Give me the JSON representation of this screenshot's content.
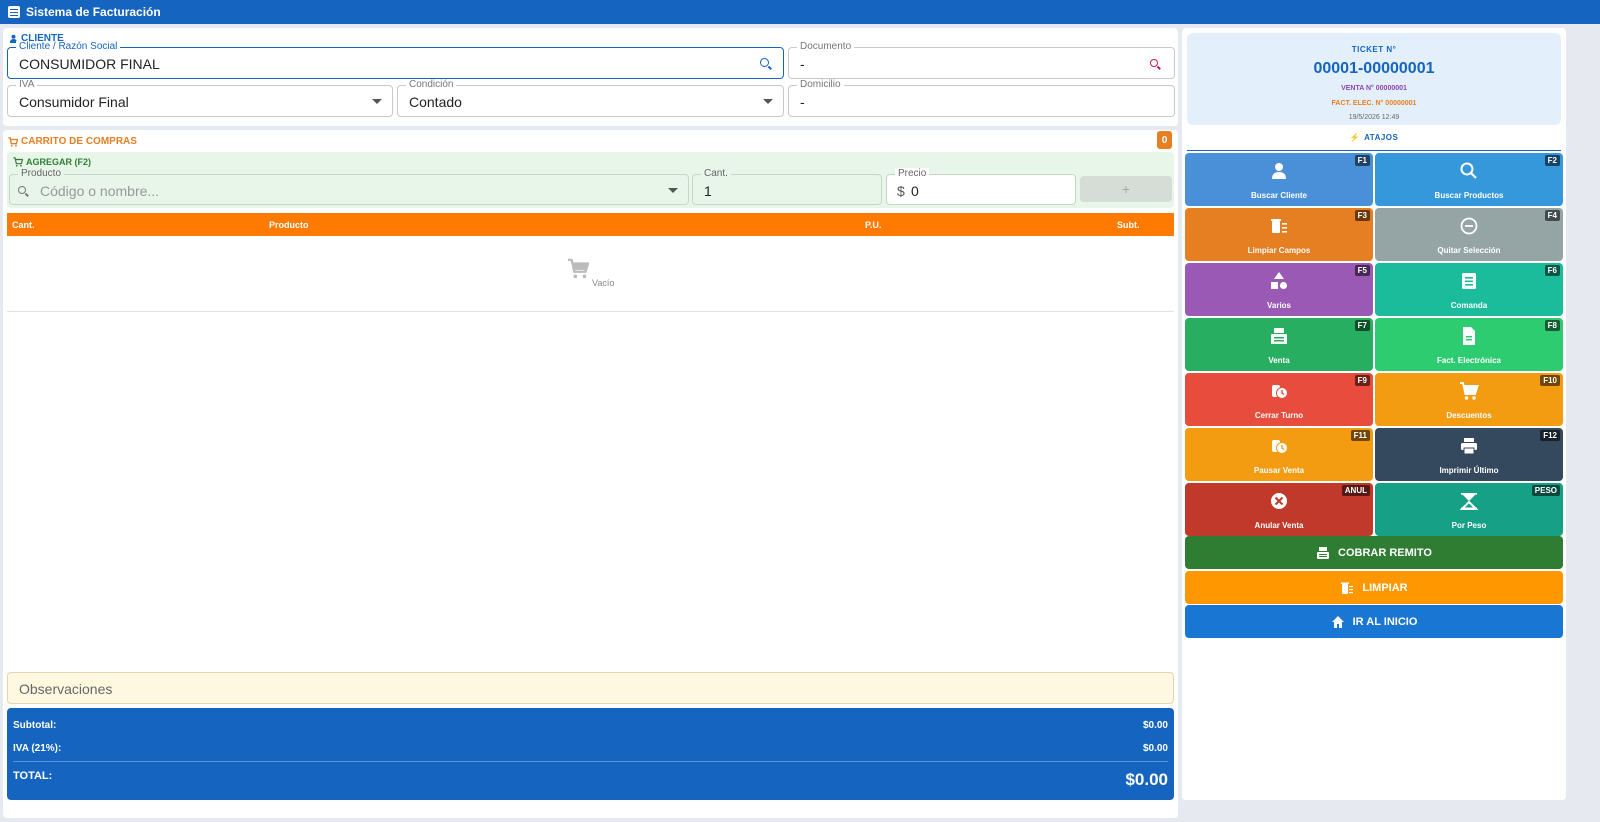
{
  "app": {
    "title": "Sistema de Facturación"
  },
  "client": {
    "section_title": "CLIENTE",
    "name_label": "Cliente / Razón Social",
    "name_value": "CONSUMIDOR FINAL",
    "doc_label": "Documento",
    "doc_value": "-",
    "iva_label": "IVA",
    "iva_value": "Consumidor Final",
    "cond_label": "Condición",
    "cond_value": "Contado",
    "dom_label": "Domicilio",
    "dom_value": "-"
  },
  "cart": {
    "section_title": "CARRITO DE COMPRAS",
    "count": "0",
    "add_title": "AGREGAR (F2)",
    "product_label": "Producto",
    "product_placeholder": "Código o nombre...",
    "qty_label": "Cant.",
    "qty_value": "1",
    "price_label": "Precio",
    "price_symbol": "$",
    "price_value": "0",
    "add_button": "+",
    "columns": {
      "qty": "Cant.",
      "product": "Producto",
      "unit": "P.U.",
      "subtotal": "Subt."
    },
    "empty_text": "Vacío",
    "observations_placeholder": "Observaciones"
  },
  "totals": {
    "subtotal_label": "Subtotal:",
    "subtotal_value": "$0.00",
    "iva_label": "IVA (21%):",
    "iva_value": "$0.00",
    "total_label": "TOTAL:",
    "total_value": "$0.00"
  },
  "ticket": {
    "label": "TICKET N°",
    "number": "00001-00000001",
    "venta": "VENTA N° 00000001",
    "fact": "FACT. ELEC. N° 00000001",
    "datetime": "19/5/2026 12:49"
  },
  "shortcuts_title": "ATAJOS",
  "shortcuts": [
    {
      "key": "F1",
      "label": "Buscar Cliente",
      "color": "#4a90d9",
      "icon": "person-icon"
    },
    {
      "key": "F2",
      "label": "Buscar Productos",
      "color": "#3498db",
      "icon": "search-icon"
    },
    {
      "key": "F3",
      "label": "Limpiar Campos",
      "color": "#e67e22",
      "icon": "clear-icon"
    },
    {
      "key": "F4",
      "label": "Quitar Selección",
      "color": "#95a5a6",
      "icon": "remove-circle-icon"
    },
    {
      "key": "F5",
      "label": "Varios",
      "color": "#9b59b6",
      "icon": "shapes-icon"
    },
    {
      "key": "F6",
      "label": "Comanda",
      "color": "#1abc9c",
      "icon": "list-icon"
    },
    {
      "key": "F7",
      "label": "Venta",
      "color": "#27ae60",
      "icon": "register-icon"
    },
    {
      "key": "F8",
      "label": "Fact. Electrónica",
      "color": "#2ecc71",
      "icon": "document-icon"
    },
    {
      "key": "F9",
      "label": "Cerrar Turno",
      "color": "#e74c3c",
      "icon": "clock-icon"
    },
    {
      "key": "F10",
      "label": "Descuentos",
      "color": "#f39c12",
      "icon": "cart-icon"
    },
    {
      "key": "F11",
      "label": "Pausar Venta",
      "color": "#f39c12",
      "icon": "pause-clock-icon"
    },
    {
      "key": "F12",
      "label": "Imprimir Último",
      "color": "#34495e",
      "icon": "print-icon"
    },
    {
      "key": "ANUL",
      "label": "Anular Venta",
      "color": "#c0392b",
      "icon": "cancel-icon"
    },
    {
      "key": "PESO",
      "label": "Por Peso",
      "color": "#16a085",
      "icon": "scale-icon"
    }
  ],
  "actions": {
    "cobrar": "COBRAR REMITO",
    "limpiar": "LIMPIAR",
    "inicio": "IR AL INICIO"
  },
  "colors": {
    "primary": "#1565c0",
    "orange": "#ff7a00",
    "cobrar": "#2e7d32",
    "limpiar": "#ff9800",
    "inicio": "#1976d2"
  }
}
